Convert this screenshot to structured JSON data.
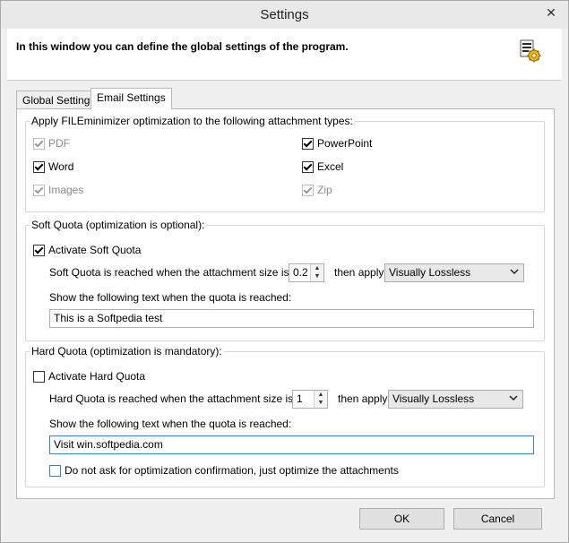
{
  "window": {
    "title": "Settings",
    "close": "✕"
  },
  "header": {
    "text": "In this window you can define the global settings of the program."
  },
  "tabs": [
    {
      "label": "Global Settings"
    },
    {
      "label": "Email Settings"
    }
  ],
  "attachments": {
    "legend": "Apply FILEminimizer optimization to the following attachment types:",
    "types": [
      {
        "label": "PDF",
        "checked": true,
        "disabled": true
      },
      {
        "label": "PowerPoint",
        "checked": true,
        "disabled": false
      },
      {
        "label": "Word",
        "checked": true,
        "disabled": false
      },
      {
        "label": "Excel",
        "checked": true,
        "disabled": false
      },
      {
        "label": "Images",
        "checked": true,
        "disabled": true
      },
      {
        "label": "Zip",
        "checked": true,
        "disabled": true
      }
    ]
  },
  "soft_quota": {
    "legend": "Soft Quota (optimization is optional):",
    "activate_label": "Activate Soft Quota",
    "activate_checked": true,
    "size_label": "Soft Quota is reached when the attachment size is MB:",
    "size_value": "0.2",
    "then_apply_label": "then apply:",
    "apply_value": "Visually Lossless",
    "text_label": "Show the following text when the quota is reached:",
    "text_value": "This is a Softpedia test"
  },
  "hard_quota": {
    "legend": "Hard Quota (optimization is mandatory):",
    "activate_label": "Activate Hard Quota",
    "activate_checked": false,
    "size_label": "Hard Quota is reached when the attachment size is MB:",
    "size_value": "1",
    "then_apply_label": "then apply:",
    "apply_value": "Visually Lossless",
    "text_label": "Show the following text when the quota is reached:",
    "text_value": "Visit win.softpedia.com",
    "no_confirm_label": "Do not ask for optimization confirmation, just optimize the attachments",
    "no_confirm_checked": false
  },
  "footer": {
    "ok_label": "OK",
    "cancel_label": "Cancel"
  },
  "icons": {
    "close": "close-icon",
    "settings": "settings-gear-icon",
    "spin_up": "▲",
    "spin_down": "▼",
    "dropdown": "chevron-down-icon"
  }
}
